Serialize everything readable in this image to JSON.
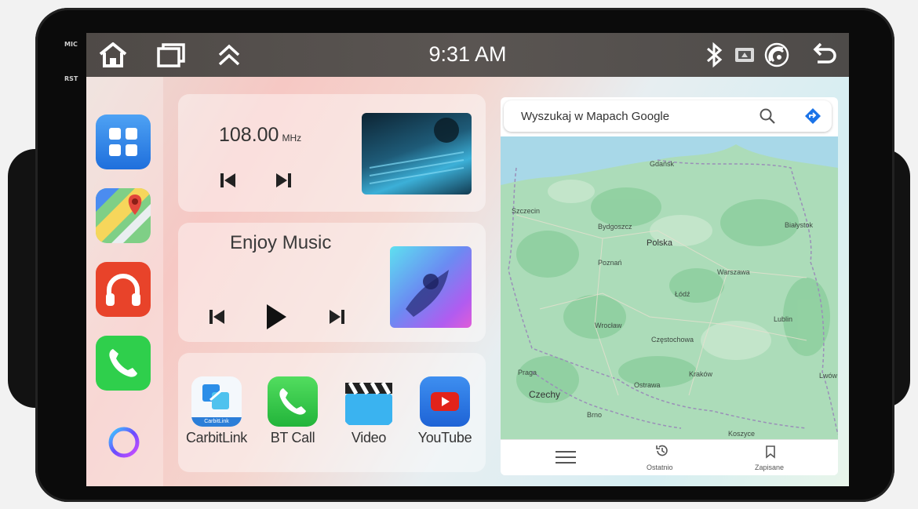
{
  "device": {
    "mic_label": "MIC",
    "rst_label": "RST"
  },
  "statusbar": {
    "time": "9:31 AM"
  },
  "radio": {
    "frequency": "108.00",
    "unit": "MHz"
  },
  "music": {
    "title": "Enjoy Music"
  },
  "apps": [
    {
      "label": "CarbitLink",
      "badge": "CarbitLink"
    },
    {
      "label": "BT Call"
    },
    {
      "label": "Video"
    },
    {
      "label": "YouTube"
    }
  ],
  "maps": {
    "search_placeholder": "Wyszukaj w Mapach Google",
    "labels": {
      "gdansk": "Gdańsk",
      "szczecin": "Szczecin",
      "bydgoszcz": "Bydgoszcz",
      "polska": "Polska",
      "poznan": "Poznań",
      "warszawa": "Warszawa",
      "lodz": "Łódź",
      "bialystok": "Białystok",
      "wroclaw": "Wrocław",
      "czestochowa": "Częstochowa",
      "lublin": "Lublin",
      "praga": "Praga",
      "krakow": "Kraków",
      "ostrawa": "Ostrawa",
      "lwow": "Lwów",
      "czechy": "Czechy",
      "brno": "Brno",
      "koszyce": "Koszyce"
    },
    "nav": {
      "recent": "Ostatnio",
      "saved": "Zapisane"
    }
  },
  "colors": {
    "statusbar": "#545050",
    "dock_apps": "#2f7de1",
    "phone_green": "#2fcf4c",
    "music_red": "#e8432a",
    "youtube_red": "#e2231a"
  }
}
